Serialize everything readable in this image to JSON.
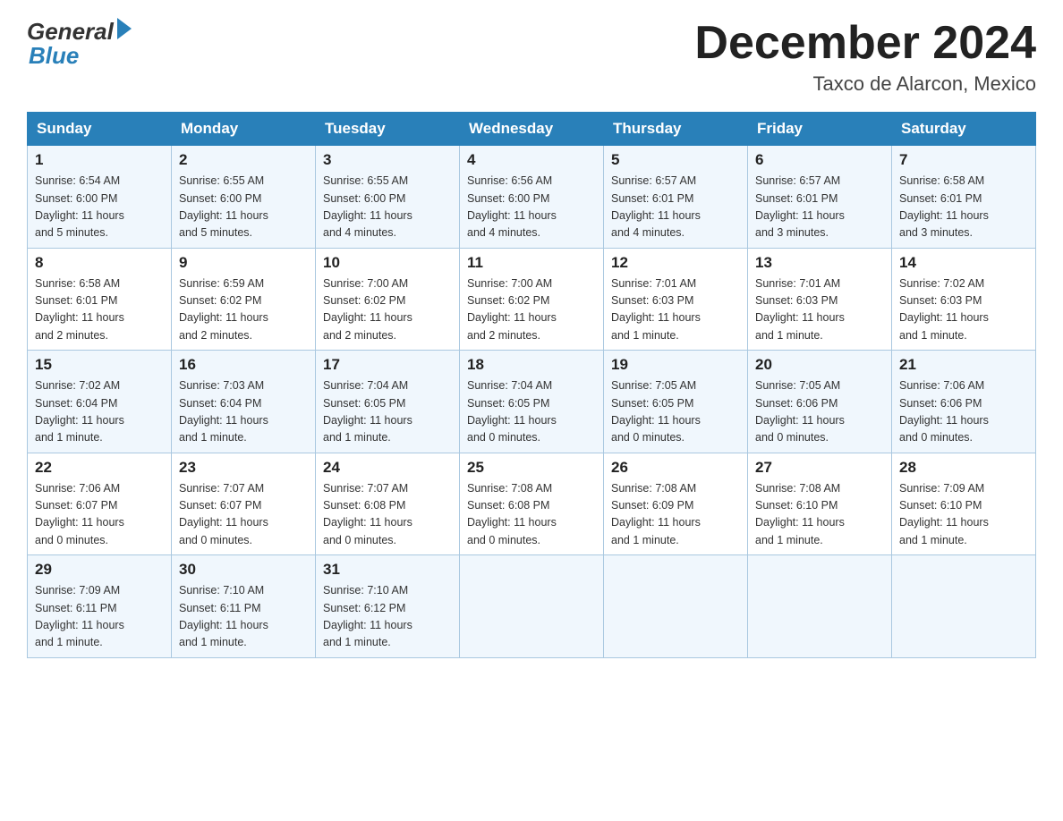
{
  "header": {
    "logo": {
      "general": "General",
      "blue": "Blue"
    },
    "title": "December 2024",
    "location": "Taxco de Alarcon, Mexico"
  },
  "weekdays": [
    "Sunday",
    "Monday",
    "Tuesday",
    "Wednesday",
    "Thursday",
    "Friday",
    "Saturday"
  ],
  "weeks": [
    [
      {
        "day": "1",
        "sunrise": "6:54 AM",
        "sunset": "6:00 PM",
        "daylight": "11 hours and 5 minutes."
      },
      {
        "day": "2",
        "sunrise": "6:55 AM",
        "sunset": "6:00 PM",
        "daylight": "11 hours and 5 minutes."
      },
      {
        "day": "3",
        "sunrise": "6:55 AM",
        "sunset": "6:00 PM",
        "daylight": "11 hours and 4 minutes."
      },
      {
        "day": "4",
        "sunrise": "6:56 AM",
        "sunset": "6:00 PM",
        "daylight": "11 hours and 4 minutes."
      },
      {
        "day": "5",
        "sunrise": "6:57 AM",
        "sunset": "6:01 PM",
        "daylight": "11 hours and 4 minutes."
      },
      {
        "day": "6",
        "sunrise": "6:57 AM",
        "sunset": "6:01 PM",
        "daylight": "11 hours and 3 minutes."
      },
      {
        "day": "7",
        "sunrise": "6:58 AM",
        "sunset": "6:01 PM",
        "daylight": "11 hours and 3 minutes."
      }
    ],
    [
      {
        "day": "8",
        "sunrise": "6:58 AM",
        "sunset": "6:01 PM",
        "daylight": "11 hours and 2 minutes."
      },
      {
        "day": "9",
        "sunrise": "6:59 AM",
        "sunset": "6:02 PM",
        "daylight": "11 hours and 2 minutes."
      },
      {
        "day": "10",
        "sunrise": "7:00 AM",
        "sunset": "6:02 PM",
        "daylight": "11 hours and 2 minutes."
      },
      {
        "day": "11",
        "sunrise": "7:00 AM",
        "sunset": "6:02 PM",
        "daylight": "11 hours and 2 minutes."
      },
      {
        "day": "12",
        "sunrise": "7:01 AM",
        "sunset": "6:03 PM",
        "daylight": "11 hours and 1 minute."
      },
      {
        "day": "13",
        "sunrise": "7:01 AM",
        "sunset": "6:03 PM",
        "daylight": "11 hours and 1 minute."
      },
      {
        "day": "14",
        "sunrise": "7:02 AM",
        "sunset": "6:03 PM",
        "daylight": "11 hours and 1 minute."
      }
    ],
    [
      {
        "day": "15",
        "sunrise": "7:02 AM",
        "sunset": "6:04 PM",
        "daylight": "11 hours and 1 minute."
      },
      {
        "day": "16",
        "sunrise": "7:03 AM",
        "sunset": "6:04 PM",
        "daylight": "11 hours and 1 minute."
      },
      {
        "day": "17",
        "sunrise": "7:04 AM",
        "sunset": "6:05 PM",
        "daylight": "11 hours and 1 minute."
      },
      {
        "day": "18",
        "sunrise": "7:04 AM",
        "sunset": "6:05 PM",
        "daylight": "11 hours and 0 minutes."
      },
      {
        "day": "19",
        "sunrise": "7:05 AM",
        "sunset": "6:05 PM",
        "daylight": "11 hours and 0 minutes."
      },
      {
        "day": "20",
        "sunrise": "7:05 AM",
        "sunset": "6:06 PM",
        "daylight": "11 hours and 0 minutes."
      },
      {
        "day": "21",
        "sunrise": "7:06 AM",
        "sunset": "6:06 PM",
        "daylight": "11 hours and 0 minutes."
      }
    ],
    [
      {
        "day": "22",
        "sunrise": "7:06 AM",
        "sunset": "6:07 PM",
        "daylight": "11 hours and 0 minutes."
      },
      {
        "day": "23",
        "sunrise": "7:07 AM",
        "sunset": "6:07 PM",
        "daylight": "11 hours and 0 minutes."
      },
      {
        "day": "24",
        "sunrise": "7:07 AM",
        "sunset": "6:08 PM",
        "daylight": "11 hours and 0 minutes."
      },
      {
        "day": "25",
        "sunrise": "7:08 AM",
        "sunset": "6:08 PM",
        "daylight": "11 hours and 0 minutes."
      },
      {
        "day": "26",
        "sunrise": "7:08 AM",
        "sunset": "6:09 PM",
        "daylight": "11 hours and 1 minute."
      },
      {
        "day": "27",
        "sunrise": "7:08 AM",
        "sunset": "6:10 PM",
        "daylight": "11 hours and 1 minute."
      },
      {
        "day": "28",
        "sunrise": "7:09 AM",
        "sunset": "6:10 PM",
        "daylight": "11 hours and 1 minute."
      }
    ],
    [
      {
        "day": "29",
        "sunrise": "7:09 AM",
        "sunset": "6:11 PM",
        "daylight": "11 hours and 1 minute."
      },
      {
        "day": "30",
        "sunrise": "7:10 AM",
        "sunset": "6:11 PM",
        "daylight": "11 hours and 1 minute."
      },
      {
        "day": "31",
        "sunrise": "7:10 AM",
        "sunset": "6:12 PM",
        "daylight": "11 hours and 1 minute."
      },
      null,
      null,
      null,
      null
    ]
  ],
  "labels": {
    "sunrise": "Sunrise:",
    "sunset": "Sunset:",
    "daylight": "Daylight:"
  }
}
